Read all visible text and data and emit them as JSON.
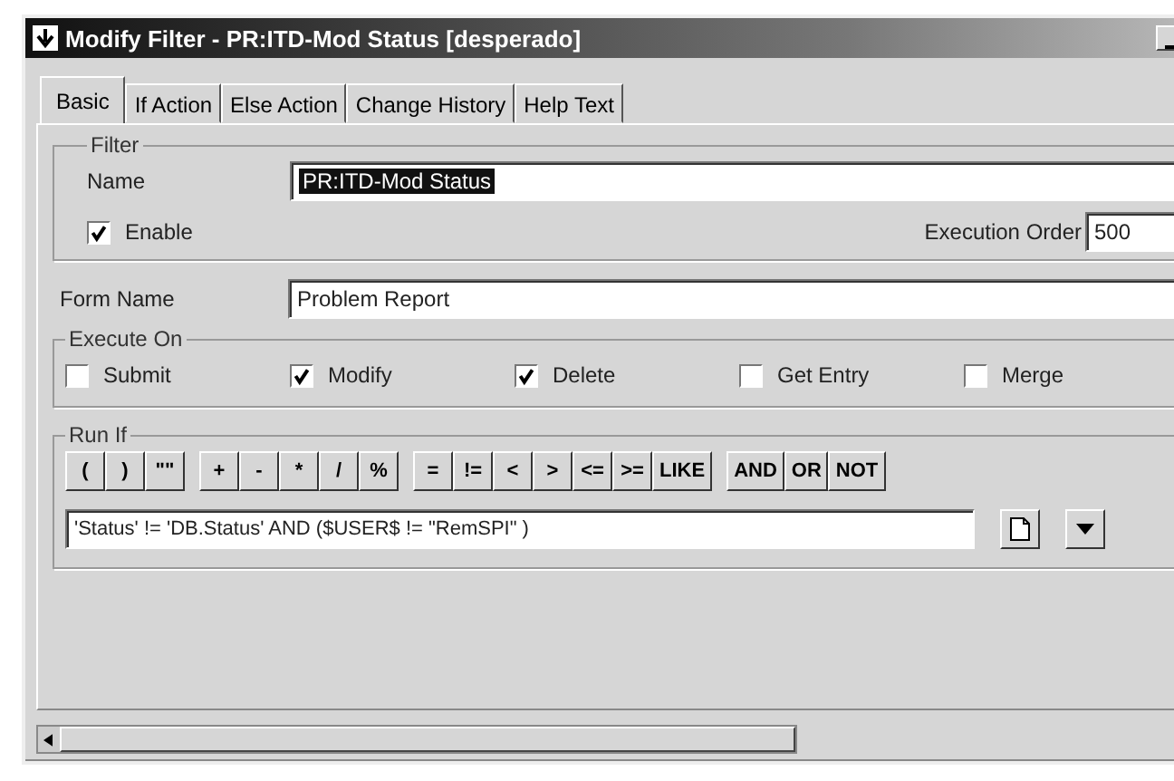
{
  "window": {
    "title": "Modify Filter - PR:ITD-Mod Status [desperado]"
  },
  "tabs": [
    {
      "label": "Basic",
      "selected": true
    },
    {
      "label": "If Action",
      "selected": false
    },
    {
      "label": "Else Action",
      "selected": false
    },
    {
      "label": "Change History",
      "selected": false
    },
    {
      "label": "Help Text",
      "selected": false
    }
  ],
  "filter": {
    "legend": "Filter",
    "name_label": "Name",
    "name_value": "PR:ITD-Mod Status",
    "enable": {
      "label": "Enable",
      "checked": true
    },
    "order_label": "Execution Order",
    "order_value": "500"
  },
  "form": {
    "label": "Form Name",
    "value": "Problem Report"
  },
  "execute_on": {
    "legend": "Execute On",
    "options": [
      {
        "label": "Submit",
        "checked": false
      },
      {
        "label": "Modify",
        "checked": true
      },
      {
        "label": "Delete",
        "checked": true
      },
      {
        "label": "Get Entry",
        "checked": false
      },
      {
        "label": "Merge",
        "checked": false
      }
    ]
  },
  "run_if": {
    "legend": "Run If",
    "operator_groups": [
      [
        "(",
        ")",
        "\"\""
      ],
      [
        "+",
        "-",
        "*",
        "/",
        "%"
      ],
      [
        "=",
        "!=",
        "<",
        ">",
        "<=",
        ">=",
        "LIKE"
      ],
      [
        "AND",
        "OR",
        "NOT"
      ]
    ],
    "expression": "'Status' != 'DB.Status' AND ($USER$ != \"RemSPI\" )"
  }
}
